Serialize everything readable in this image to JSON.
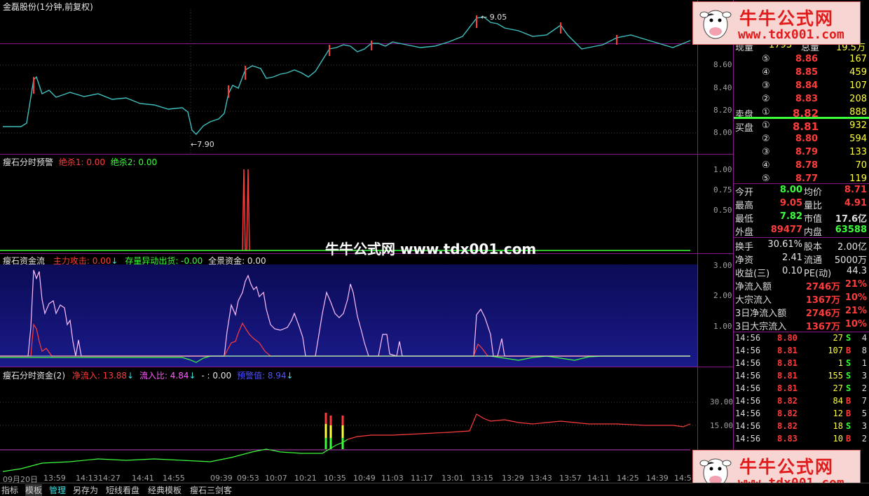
{
  "main_chart": {
    "title": "金磊股份(1分钟,前复权)",
    "high_label": "9.05",
    "low_label": "7.90",
    "y_ticks": [
      "8.60",
      "8.40",
      "8.20",
      "8.00"
    ]
  },
  "panel1": {
    "name": "瘦石分时预警",
    "l1": "绝杀1: 0.00",
    "l2": "绝杀2: 0.00",
    "y_ticks": [
      "1.00",
      "0.75",
      "0.50"
    ]
  },
  "panel2": {
    "name": "瘦石资金流",
    "l1": "主力攻击: 0.00",
    "l2": "存量异动出货: -0.00",
    "l3": "全景资金: 0.00",
    "y_ticks": [
      "3.00",
      "2.00",
      "1.00"
    ]
  },
  "panel3": {
    "name": "瘦石分时资金(2)",
    "l1": "净流入: 13.88",
    "l2": "流入比: 4.84",
    "l3": "- : 0.00",
    "l4": "预警值: 8.94",
    "y_ticks": [
      "30.00",
      "15.00"
    ]
  },
  "watermark": "牛牛公式网 www.tdx001.com",
  "time_axis": [
    "09月20日",
    "13:59",
    "14:13",
    "14:27",
    "14:41",
    "14:55",
    "09:39",
    "09:53",
    "10:07",
    "10:21",
    "10:35",
    "10:49",
    "11:03",
    "11:17",
    "13:01",
    "13:15",
    "13:29",
    "13:43",
    "13:57",
    "14:11",
    "14:25",
    "14:39",
    "14:5"
  ],
  "logo": {
    "cn": "牛牛公式网",
    "url": "www.tdx001.com"
  },
  "quote": {
    "top": {
      "l1": "现量",
      "v1": "1793",
      "l2": "总量",
      "v2": "19.5万"
    },
    "sell": [
      {
        "idx": "⑤",
        "price": "8.86",
        "vol": "167"
      },
      {
        "idx": "④",
        "price": "8.85",
        "vol": "459"
      },
      {
        "idx": "③",
        "price": "8.84",
        "vol": "107"
      },
      {
        "idx": "②",
        "price": "8.83",
        "vol": "208"
      },
      {
        "idx": "①",
        "price": "8.82",
        "vol": "888"
      }
    ],
    "sell_label": "卖盘",
    "buy_label": "买盘",
    "buy": [
      {
        "idx": "①",
        "price": "8.81",
        "vol": "932"
      },
      {
        "idx": "②",
        "price": "8.80",
        "vol": "594"
      },
      {
        "idx": "③",
        "price": "8.79",
        "vol": "133"
      },
      {
        "idx": "④",
        "price": "8.78",
        "vol": "70"
      },
      {
        "idx": "⑤",
        "price": "8.77",
        "vol": "119"
      }
    ],
    "stats": [
      {
        "a": "今开",
        "av": "8.00",
        "b": "均价",
        "bv": "8.71"
      },
      {
        "a": "最高",
        "av": "9.05",
        "b": "量比",
        "bv": "4.91"
      },
      {
        "a": "最低",
        "av": "7.82",
        "b": "市值",
        "bv": "17.6亿"
      },
      {
        "a": "外盘",
        "av": "89477",
        "b": "内盘",
        "bv": "63588"
      }
    ],
    "stats2": [
      {
        "a": "换手",
        "av": "30.61%",
        "b": "股本",
        "bv": "2.00亿"
      },
      {
        "a": "净资",
        "av": "2.41",
        "b": "流通",
        "bv": "5000万"
      },
      {
        "a": "收益(三)",
        "av": "0.10",
        "b": "PE(动)",
        "bv": "44.3"
      }
    ],
    "flows": [
      {
        "label": "净流入额",
        "val": "2746万",
        "pct": "21%"
      },
      {
        "label": "大宗流入",
        "val": "1367万",
        "pct": "10%"
      },
      {
        "label": "3日净流入额",
        "val": "2746万",
        "pct": "21%"
      },
      {
        "label": "3日大宗流入",
        "val": "1367万",
        "pct": "10%"
      }
    ],
    "ticks": [
      {
        "t": "14:56",
        "p": "8.80",
        "v": "27",
        "d": "S",
        "n": "4"
      },
      {
        "t": "14:56",
        "p": "8.81",
        "v": "107",
        "d": "B",
        "n": "8"
      },
      {
        "t": "14:56",
        "p": "8.81",
        "v": "1",
        "d": "S",
        "n": "1"
      },
      {
        "t": "14:56",
        "p": "8.81",
        "v": "155",
        "d": "S",
        "n": "3"
      },
      {
        "t": "14:56",
        "p": "8.81",
        "v": "27",
        "d": "S",
        "n": "2"
      },
      {
        "t": "14:56",
        "p": "8.82",
        "v": "84",
        "d": "B",
        "n": "7"
      },
      {
        "t": "14:56",
        "p": "8.82",
        "v": "12",
        "d": "B",
        "n": "5"
      },
      {
        "t": "14:56",
        "p": "8.82",
        "v": "18",
        "d": "S",
        "n": "3"
      },
      {
        "t": "14:56",
        "p": "8.83",
        "v": "10",
        "d": "B",
        "n": "2"
      }
    ]
  },
  "bottom_tabs": [
    "指标",
    "模板",
    "管理",
    "另存为",
    "短线看盘",
    "经典模板",
    "瘦石三剑客"
  ],
  "colors": {
    "up": "#ff3c3c",
    "down": "#3cff3c",
    "grid": "#8a1a8a",
    "bg": "#000000"
  }
}
